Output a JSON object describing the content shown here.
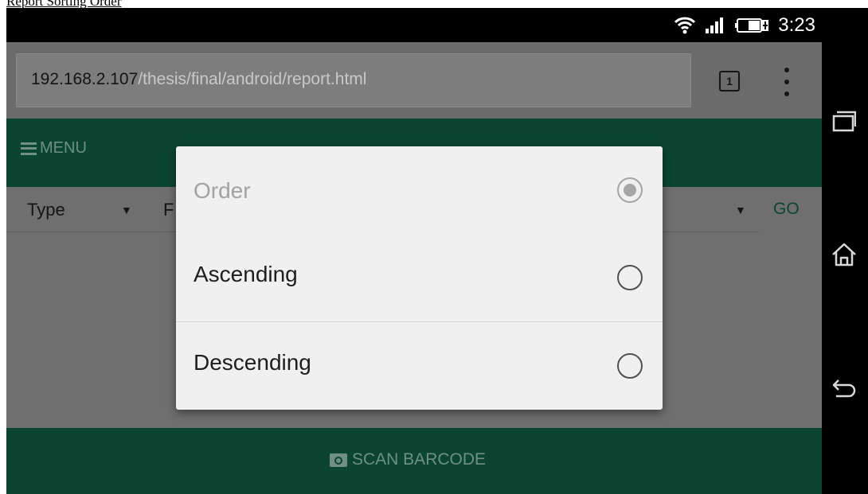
{
  "caption": "Report Sorting Order",
  "status_bar": {
    "time": "3:23",
    "icons": [
      "wifi-icon",
      "signal-icon",
      "battery-charging-icon"
    ]
  },
  "browser": {
    "url_host": "192.168.2.107",
    "url_path": "/thesis/final/android/report.html",
    "tab_count": "1"
  },
  "page": {
    "menu_label": "MENU",
    "type_select": "Type",
    "second_select_partial": "F",
    "go_label": "GO",
    "scan_label": "SCAN BARCODE"
  },
  "dialog": {
    "title": "Order",
    "options": [
      {
        "label": "Ascending",
        "selected": false
      },
      {
        "label": "Descending",
        "selected": false
      }
    ]
  },
  "navigation": [
    "recent-apps-icon",
    "home-icon",
    "back-icon"
  ],
  "colors": {
    "header_green": "#0b4532",
    "scrim_gray": "#6f6f6f",
    "dialog_bg": "#f0f0f0"
  }
}
